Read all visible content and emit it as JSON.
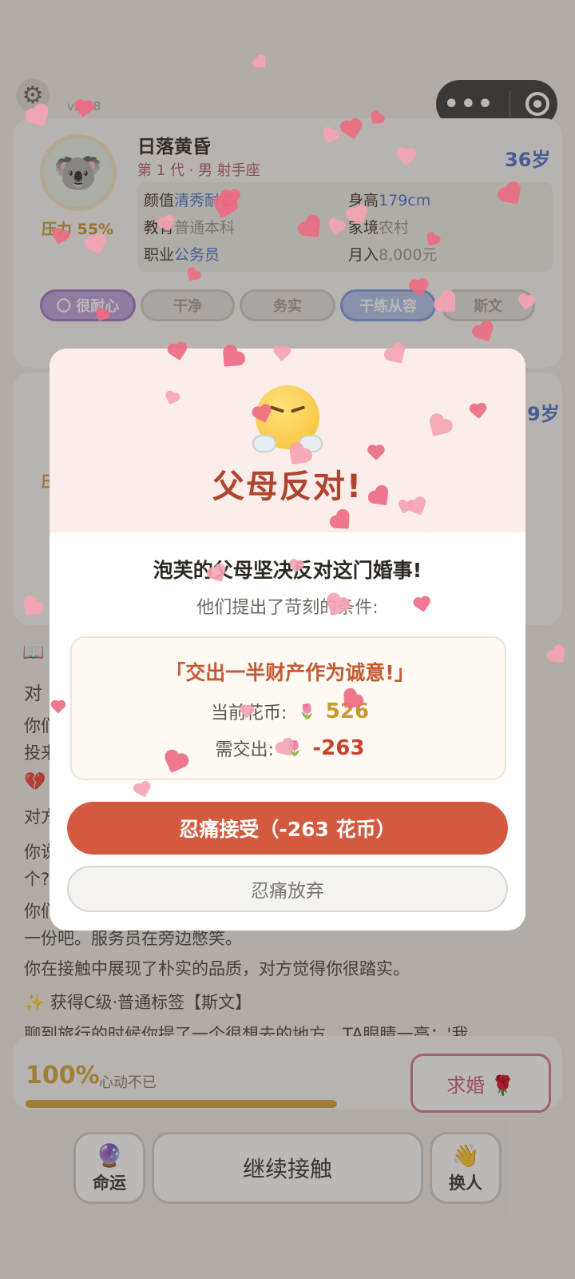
{
  "header": {
    "version": "v2.48",
    "settings_icon": "gear-icon",
    "capsule_menu_icon": "more-dots-icon",
    "capsule_close_icon": "target-circle-icon"
  },
  "profile": {
    "name": "日落黄昏",
    "generation": "第 1 代 · 男 射手座",
    "age": "36岁",
    "pressure": "压力 55%",
    "avatar_icon": "koala-icon",
    "fields": {
      "looks_label": "颜值",
      "looks_value": "清秀耐看",
      "height_label": "身高",
      "height_value": "179cm",
      "edu_label": "教育",
      "edu_value": "普通本科",
      "family_label": "家境",
      "family_value": "农村",
      "job_label": "职业",
      "job_value": "公务员",
      "income_label": "月入",
      "income_value": "8,000元"
    },
    "tags": [
      "〇 很耐心",
      "干净",
      "务实",
      "干练从容",
      "斯文"
    ]
  },
  "partner_card": {
    "age_partial": "9岁",
    "pressure_partial": "压"
  },
  "log": {
    "line_fortune_partial": "对",
    "line_a": "你们",
    "line_a2": "投来",
    "line_b": "对方",
    "line_c": "你说",
    "line_c2": "个?",
    "line_d": "你们",
    "line_d2": "一份吧。服务员在旁边憋笑。",
    "line_e": "你在接触中展现了朴实的品质，对方觉得你很踏实。",
    "line_f": "✨ 获得C级·普通标签【斯文】",
    "line_g": "聊到旅行的时候你提了一个很想去的地方，TA眼睛一亮：'我"
  },
  "progress": {
    "percent_text": "100%",
    "percent_value": 1.0,
    "subtitle": "心动不已",
    "propose_label": "求婚 🌹"
  },
  "bottom_bar": {
    "fate_label": "命运",
    "fate_icon": "crystal-ball-icon",
    "continue_label": "继续接触",
    "switch_label": "换人",
    "switch_icon": "waving-hand-icon"
  },
  "modal": {
    "emoji": "huffing-face-icon",
    "title": "父母反对!",
    "subtitle1": "泡芙的父母坚决反对这门婚事!",
    "subtitle2": "他们提出了苛刻的条件:",
    "condition_quote": "「交出一半财产作为诚意!」",
    "current_label": "当前花币:",
    "current_value": "526",
    "pay_label": "需交出:",
    "pay_value": "-263",
    "accept_label": "忍痛接受（-263 花币）",
    "giveup_label": "忍痛放弃"
  },
  "colors": {
    "accent_red": "#d35a3f",
    "title_red": "#b0442e",
    "gold": "#c89a2a",
    "link_blue": "#4f70c9",
    "petal_pink": "#ee6b82"
  }
}
